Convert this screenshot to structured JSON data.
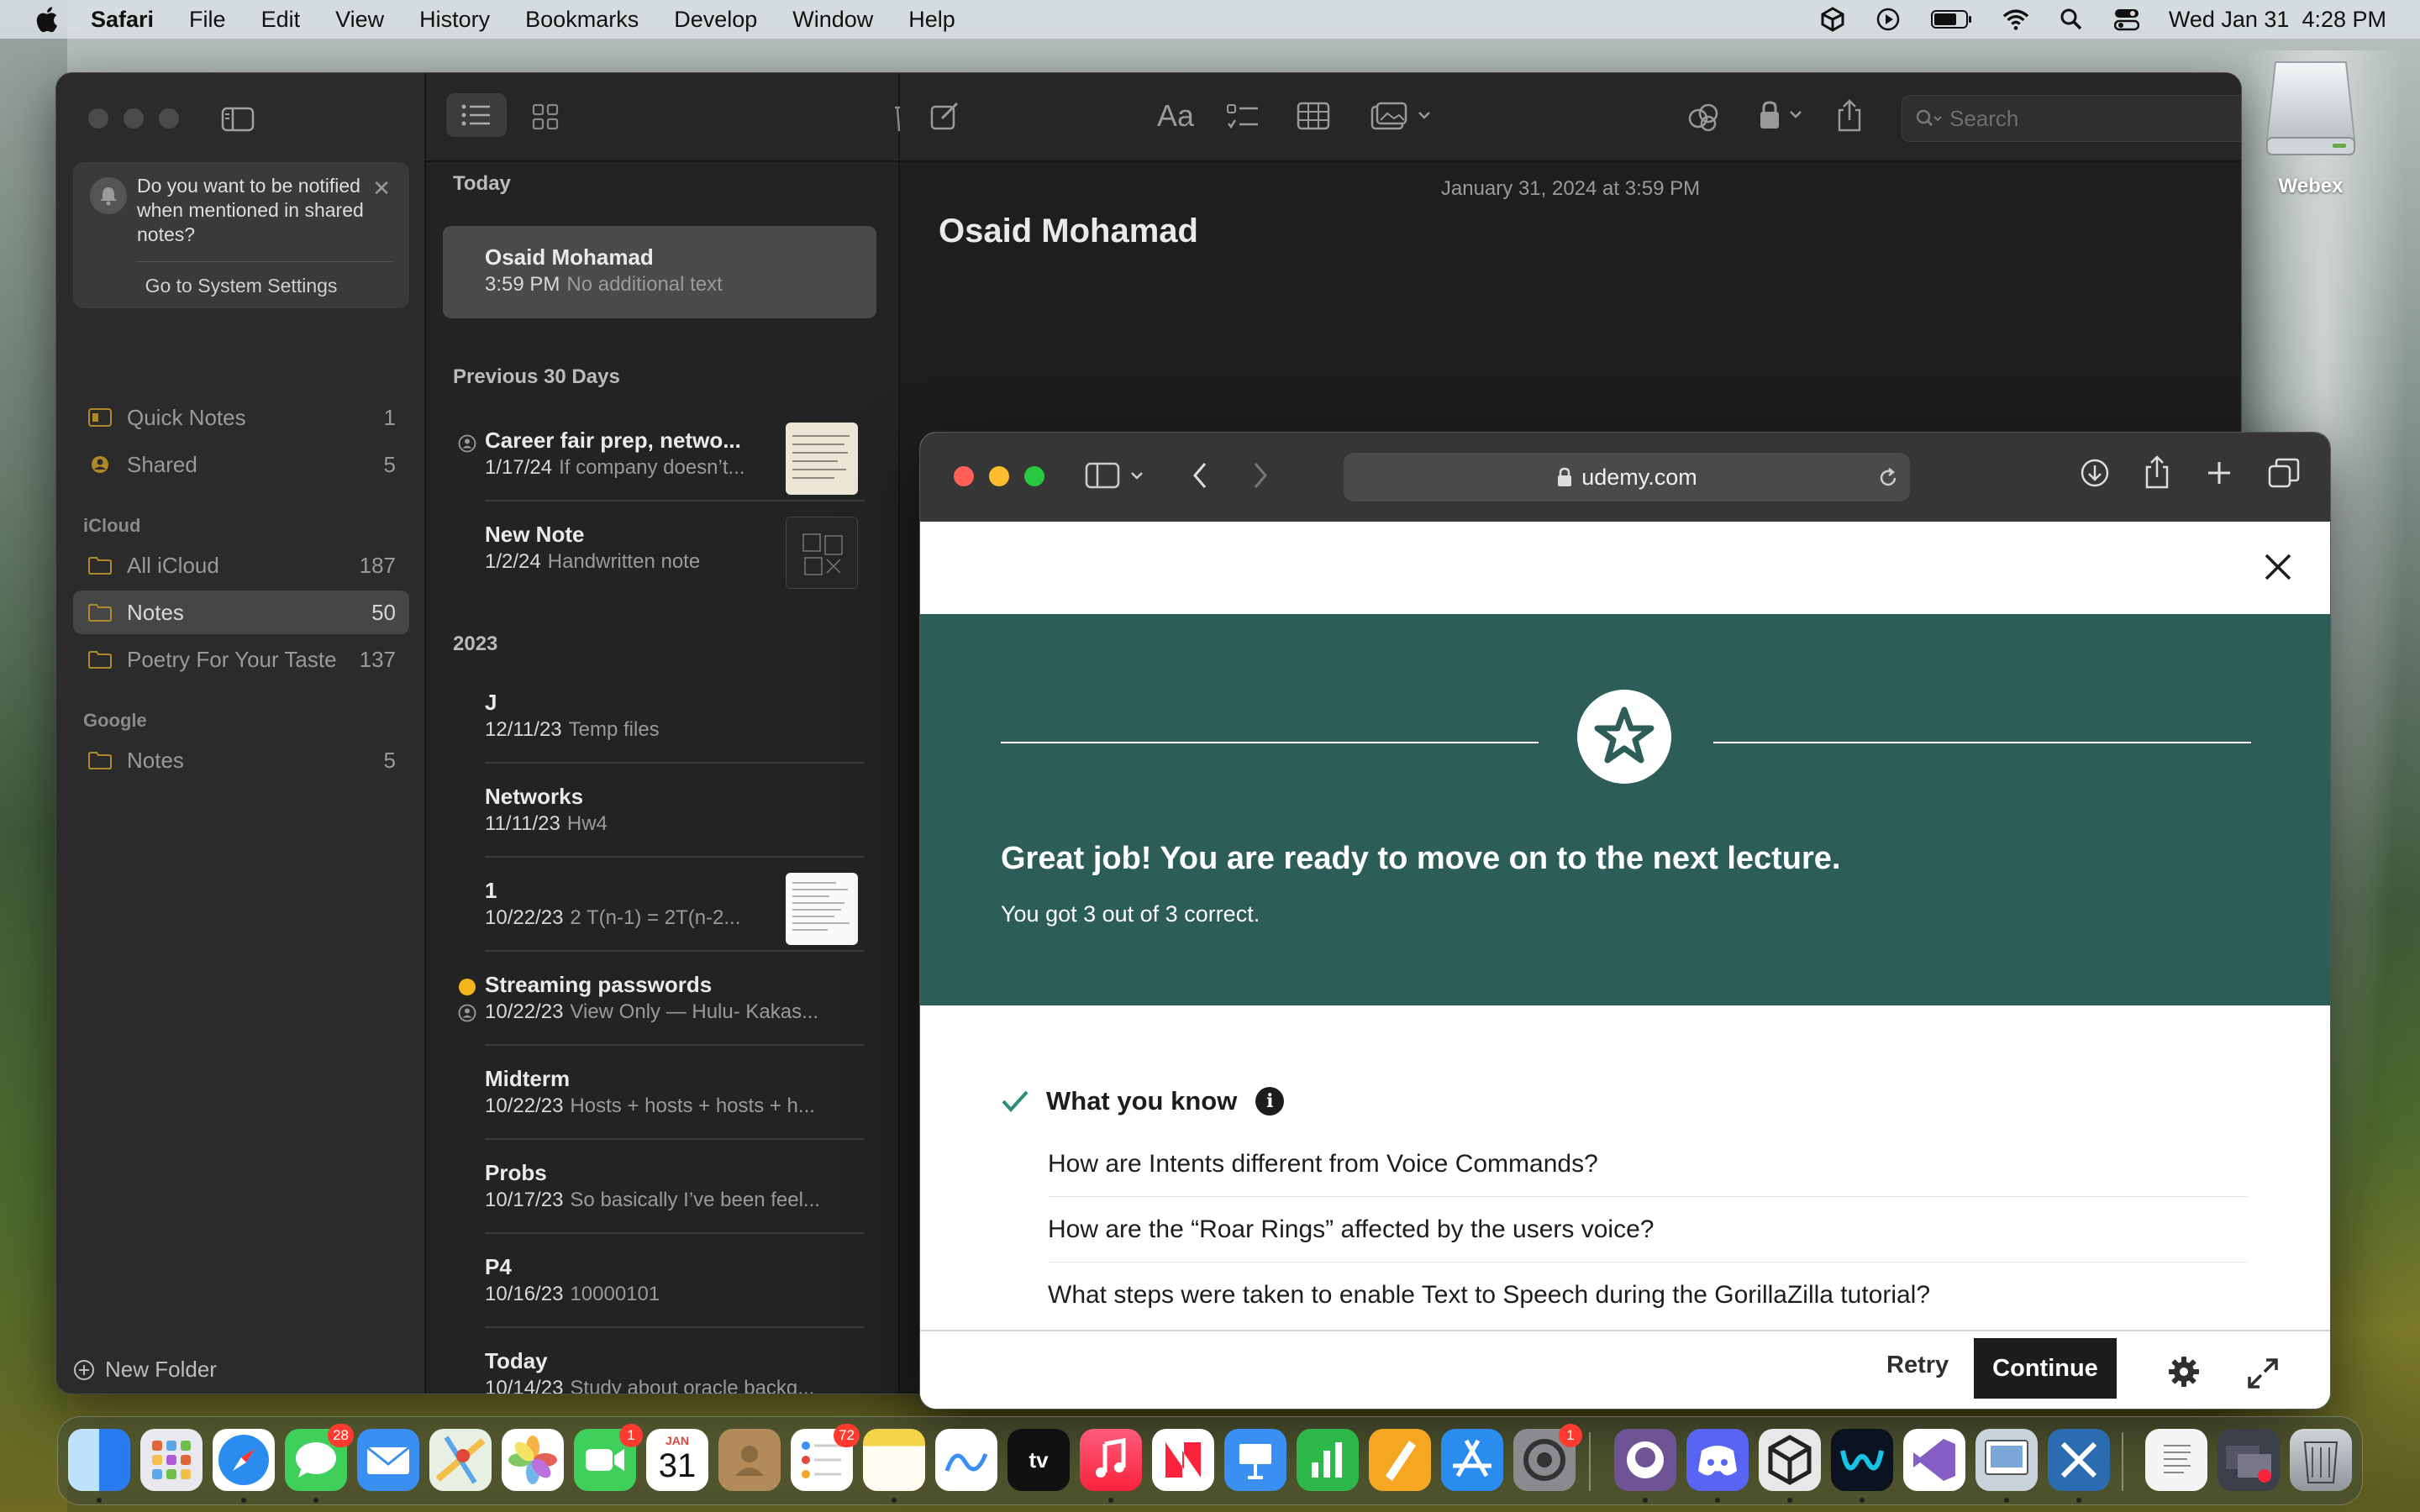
{
  "menubar": {
    "app": "Safari",
    "items": [
      "File",
      "Edit",
      "View",
      "History",
      "Bookmarks",
      "Develop",
      "Window",
      "Help"
    ],
    "clock": "Wed Jan 31  4:28 PM"
  },
  "notes": {
    "notification": {
      "message": "Do you want to be notified when mentioned in shared notes?",
      "link": "Go to System Settings"
    },
    "sidebar": {
      "top": [
        {
          "label": "Quick Notes",
          "count": "1"
        },
        {
          "label": "Shared",
          "count": "5"
        }
      ],
      "icloud_header": "iCloud",
      "icloud": [
        {
          "label": "All iCloud",
          "count": "187"
        },
        {
          "label": "Notes",
          "count": "50"
        },
        {
          "label": "Poetry For Your Taste",
          "count": "137"
        }
      ],
      "google_header": "Google",
      "google": [
        {
          "label": "Notes",
          "count": "5"
        }
      ],
      "new_folder": "New Folder"
    },
    "list": {
      "today_header": "Today",
      "prev_header": "Previous 30 Days",
      "year_header": "2023",
      "items": [
        {
          "title": "Osaid Mohamad",
          "date": "3:59 PM",
          "preview": "No additional text"
        },
        {
          "title": "Career fair prep, netwo...",
          "date": "1/17/24",
          "preview": "If company doesn’t..."
        },
        {
          "title": "New Note",
          "date": "1/2/24",
          "preview": "Handwritten note"
        },
        {
          "title": "J",
          "date": "12/11/23",
          "preview": "Temp files"
        },
        {
          "title": "Networks",
          "date": "11/11/23",
          "preview": "Hw4"
        },
        {
          "title": "1",
          "date": "10/22/23",
          "preview": "2 T(n-1) = 2T(n-2..."
        },
        {
          "title": "Streaming passwords",
          "date": "10/22/23",
          "preview": "View Only — Hulu- Kakas..."
        },
        {
          "title": "Midterm",
          "date": "10/22/23",
          "preview": "Hosts + hosts + hosts + h..."
        },
        {
          "title": "Probs",
          "date": "10/17/23",
          "preview": "So basically I’ve been feel..."
        },
        {
          "title": "P4",
          "date": "10/16/23",
          "preview": "10000101"
        },
        {
          "title": "Today",
          "date": "10/14/23",
          "preview": "Study about oracle backg..."
        }
      ]
    },
    "editor": {
      "date": "January 31, 2024 at 3:59 PM",
      "title": "Osaid Mohamad",
      "search_placeholder": "Search"
    }
  },
  "safari": {
    "url": "udemy.com",
    "quiz": {
      "headline": "Great job! You are ready to move on to the next lecture.",
      "score": "You got 3 out of 3 correct.",
      "section_title": "What you know",
      "questions": [
        "How are Intents different from Voice Commands?",
        "How are the “Roar Rings” affected by the users voice?",
        "What steps were taken to enable Text to Speech during the GorillaZilla tutorial?"
      ],
      "retry": "Retry",
      "continue": "Continue"
    },
    "colors": {
      "banner": "#2c5e57",
      "check": "#2c8f7a"
    }
  },
  "desktop": {
    "drive_label": "Webex"
  },
  "dock": {
    "calendar_month": "JAN",
    "calendar_day": "31",
    "badges": {
      "messages": "28",
      "facetime": "1",
      "reminders": "72",
      "settings": "1"
    }
  }
}
